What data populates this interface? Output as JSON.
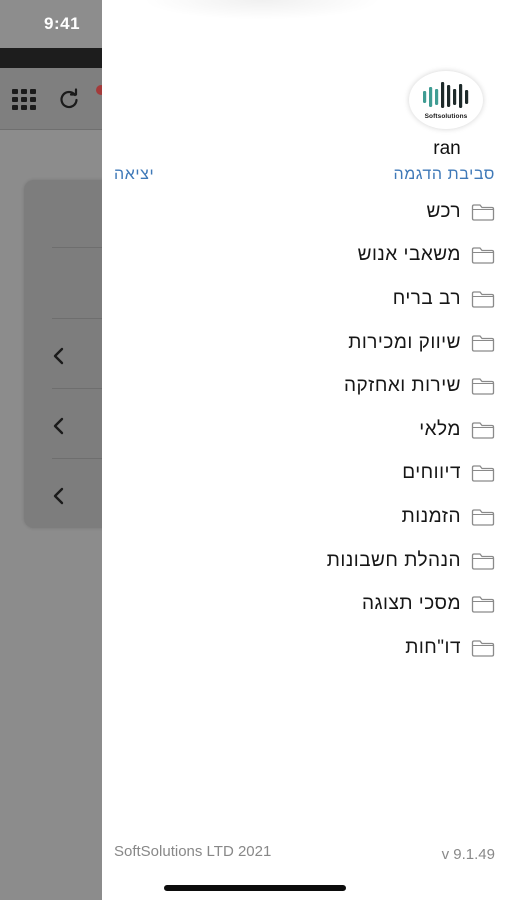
{
  "status_bar": {
    "time": "9:41"
  },
  "drawer": {
    "logo_text": "Softsolutions",
    "username": "ran",
    "environment_link": "סביבת הדגמה",
    "logout_link": "יציאה",
    "menu_items": [
      {
        "label": "רכש",
        "icon": "folder-icon"
      },
      {
        "label": "משאבי אנוש",
        "icon": "folder-icon"
      },
      {
        "label": "רב בריח",
        "icon": "folder-icon"
      },
      {
        "label": "שיווק ומכירות",
        "icon": "folder-icon"
      },
      {
        "label": "שירות ואחזקה",
        "icon": "folder-icon"
      },
      {
        "label": "מלאי",
        "icon": "folder-icon"
      },
      {
        "label": "דיווחים",
        "icon": "folder-icon"
      },
      {
        "label": "הזמנות",
        "icon": "folder-icon"
      },
      {
        "label": "הנהלת חשבונות",
        "icon": "folder-icon"
      },
      {
        "label": "מסכי תצוגה",
        "icon": "folder-icon"
      },
      {
        "label": "דו\"חות",
        "icon": "folder-icon"
      }
    ],
    "footer_company": "SoftSolutions LTD 2021",
    "footer_version": "v 9.1.49"
  },
  "background_app": {
    "icons": [
      "grid-icon",
      "refresh-icon",
      "chevron-left-icon"
    ]
  },
  "colors": {
    "link": "#3f79b8",
    "logo_teal": "#3f9c93",
    "logo_dark": "#1e2a2a",
    "overlay": "#8c8c8c",
    "folder": "#8a8a8a"
  }
}
